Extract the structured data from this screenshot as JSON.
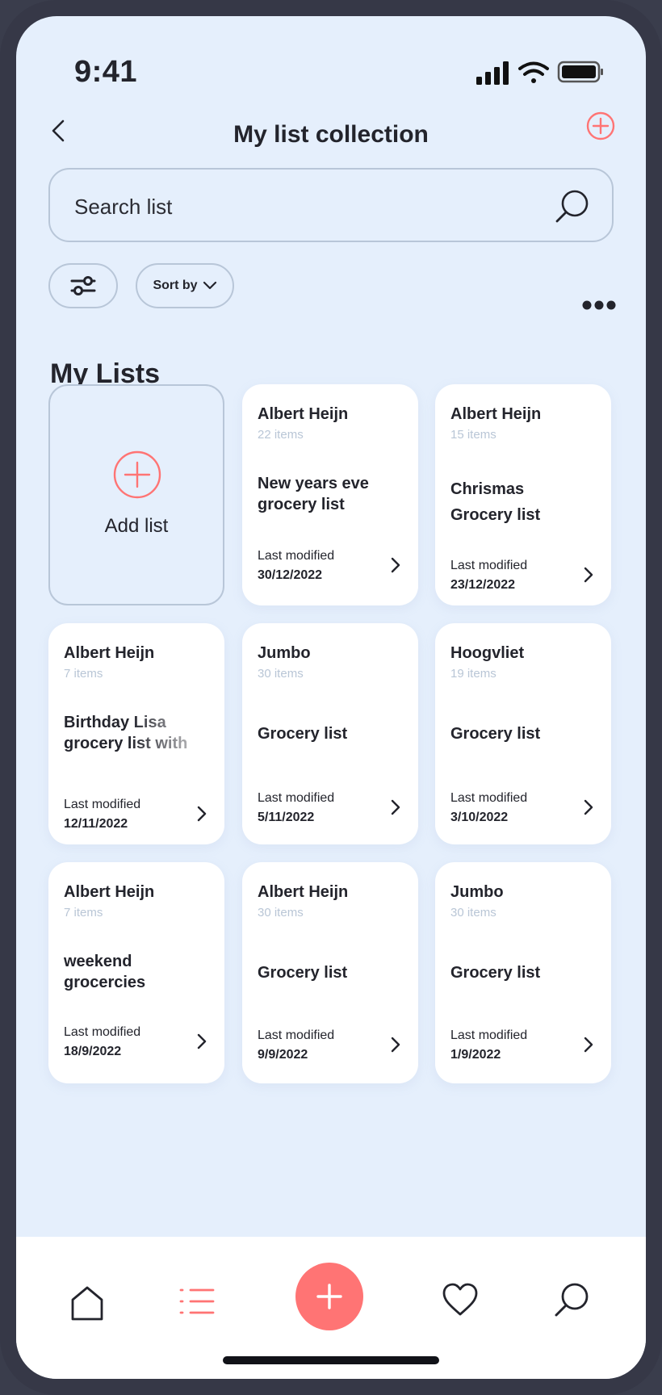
{
  "status_bar": {
    "time": "9:41"
  },
  "header": {
    "title": "My list collection"
  },
  "search": {
    "placeholder": "Search list"
  },
  "filters": {
    "sort_label": "Sort by"
  },
  "section": {
    "title": "My Lists"
  },
  "add_card": {
    "label": "Add list"
  },
  "lists": [
    {
      "store": "Albert Heijn",
      "items": "22 items",
      "title": "New years eve grocery list",
      "modified_label": "Last modified",
      "date": "30/12/2022"
    },
    {
      "store": "Albert Heijn",
      "items": "15 items",
      "title": "Chrismas Grocery list",
      "modified_label": "Last modified",
      "date": "23/12/2022"
    },
    {
      "store": "Albert Heijn",
      "items": "7 items",
      "title": "Birthday Lisa grocery list with",
      "modified_label": "Last modified",
      "date": "12/11/2022"
    },
    {
      "store": "Jumbo",
      "items": "30 items",
      "title": "Grocery list",
      "modified_label": "Last modified",
      "date": "5/11/2022"
    },
    {
      "store": "Hoogvliet",
      "items": "19 items",
      "title": "Grocery list",
      "modified_label": "Last modified",
      "date": "3/10/2022"
    },
    {
      "store": "Albert Heijn",
      "items": "7 items",
      "title": "weekend grocercies",
      "modified_label": "Last modified",
      "date": "18/9/2022"
    },
    {
      "store": "Albert Heijn",
      "items": "30 items",
      "title": "Grocery list",
      "modified_label": "Last modified",
      "date": "9/9/2022"
    },
    {
      "store": "Jumbo",
      "items": "30 items",
      "title": "Grocery list",
      "modified_label": "Last modified",
      "date": "1/9/2022"
    }
  ],
  "bottom_nav": {
    "items": [
      "home-icon",
      "list-icon",
      "plus-icon",
      "heart-icon",
      "search-icon"
    ],
    "active": "list-icon"
  },
  "colors": {
    "accent": "#ff7474",
    "background": "#e5effc",
    "card": "#ffffff",
    "muted": "#b9c6d6",
    "text": "#23242c"
  }
}
